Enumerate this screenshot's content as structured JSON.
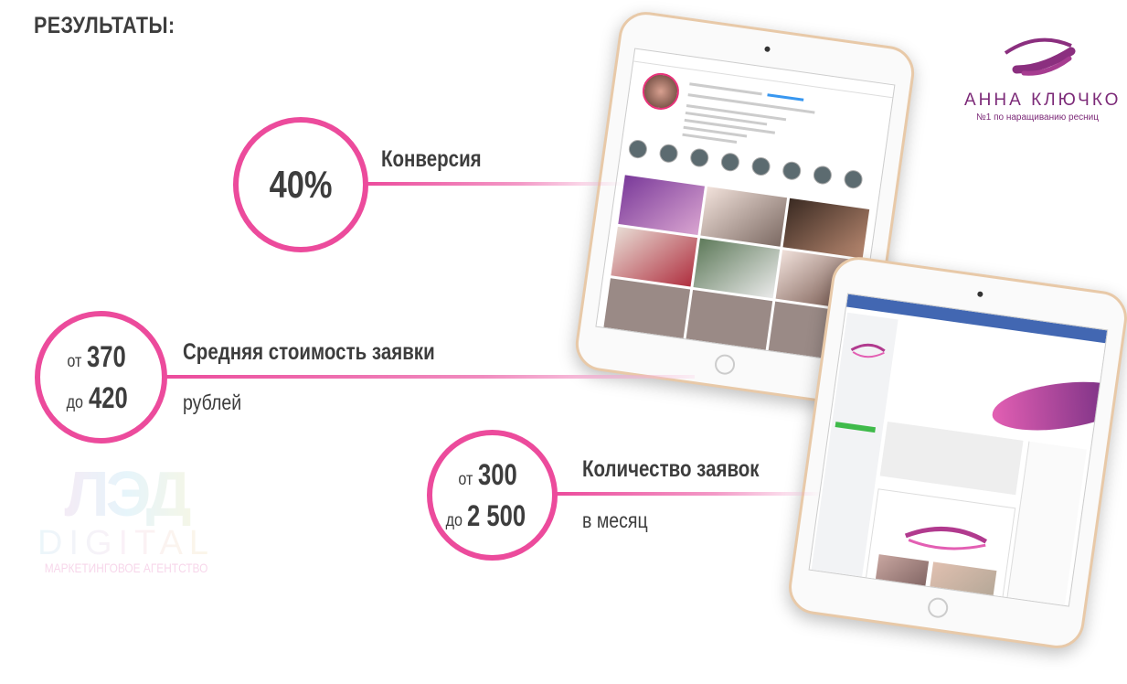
{
  "heading": "РЕЗУЛЬТАТЫ:",
  "metrics": [
    {
      "value": "40%",
      "title": "Конверсия"
    },
    {
      "from_label": "от",
      "from_value": "370",
      "to_label": "до",
      "to_value": "420",
      "title": "Средняя стоимость заявки",
      "unit": "рублей"
    },
    {
      "from_label": "от",
      "from_value": "300",
      "to_label": "до",
      "to_value": "2 500",
      "title": "Количество заявок",
      "unit": "в месяц"
    }
  ],
  "brand": {
    "name": "АННА КЛЮЧКО",
    "tagline": "№1 по наращиванию ресниц"
  },
  "watermark": {
    "title": "DIGITAL",
    "subtitle": "МАРКЕТИНГОВОЕ АГЕНТСТВО"
  },
  "colors": {
    "accent": "#ec4b9c",
    "brand": "#7c2a78",
    "text": "#3d3d3d"
  }
}
